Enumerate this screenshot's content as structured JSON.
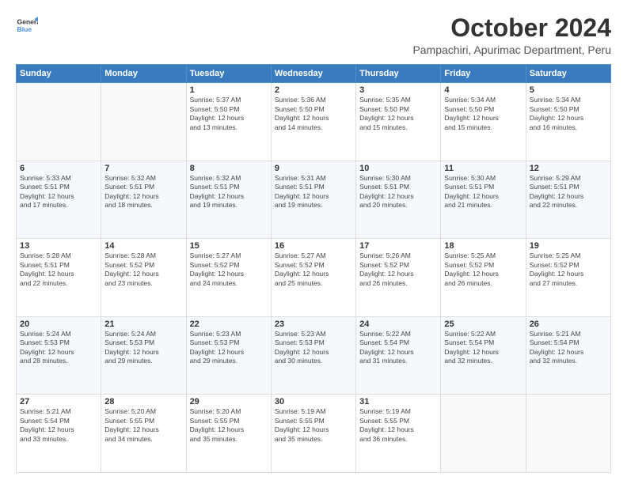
{
  "header": {
    "logo_line1": "General",
    "logo_line2": "Blue",
    "title": "October 2024",
    "subtitle": "Pampachiri, Apurimac Department, Peru"
  },
  "days_of_week": [
    "Sunday",
    "Monday",
    "Tuesday",
    "Wednesday",
    "Thursday",
    "Friday",
    "Saturday"
  ],
  "weeks": [
    [
      {
        "day": "",
        "empty": true
      },
      {
        "day": "",
        "empty": true
      },
      {
        "day": "1",
        "sunrise": "5:37 AM",
        "sunset": "5:50 PM",
        "daylight": "12 hours and 13 minutes."
      },
      {
        "day": "2",
        "sunrise": "5:36 AM",
        "sunset": "5:50 PM",
        "daylight": "12 hours and 14 minutes."
      },
      {
        "day": "3",
        "sunrise": "5:35 AM",
        "sunset": "5:50 PM",
        "daylight": "12 hours and 15 minutes."
      },
      {
        "day": "4",
        "sunrise": "5:34 AM",
        "sunset": "5:50 PM",
        "daylight": "12 hours and 15 minutes."
      },
      {
        "day": "5",
        "sunrise": "5:34 AM",
        "sunset": "5:50 PM",
        "daylight": "12 hours and 16 minutes."
      }
    ],
    [
      {
        "day": "6",
        "sunrise": "5:33 AM",
        "sunset": "5:51 PM",
        "daylight": "12 hours and 17 minutes."
      },
      {
        "day": "7",
        "sunrise": "5:32 AM",
        "sunset": "5:51 PM",
        "daylight": "12 hours and 18 minutes."
      },
      {
        "day": "8",
        "sunrise": "5:32 AM",
        "sunset": "5:51 PM",
        "daylight": "12 hours and 19 minutes."
      },
      {
        "day": "9",
        "sunrise": "5:31 AM",
        "sunset": "5:51 PM",
        "daylight": "12 hours and 19 minutes."
      },
      {
        "day": "10",
        "sunrise": "5:30 AM",
        "sunset": "5:51 PM",
        "daylight": "12 hours and 20 minutes."
      },
      {
        "day": "11",
        "sunrise": "5:30 AM",
        "sunset": "5:51 PM",
        "daylight": "12 hours and 21 minutes."
      },
      {
        "day": "12",
        "sunrise": "5:29 AM",
        "sunset": "5:51 PM",
        "daylight": "12 hours and 22 minutes."
      }
    ],
    [
      {
        "day": "13",
        "sunrise": "5:28 AM",
        "sunset": "5:51 PM",
        "daylight": "12 hours and 22 minutes."
      },
      {
        "day": "14",
        "sunrise": "5:28 AM",
        "sunset": "5:52 PM",
        "daylight": "12 hours and 23 minutes."
      },
      {
        "day": "15",
        "sunrise": "5:27 AM",
        "sunset": "5:52 PM",
        "daylight": "12 hours and 24 minutes."
      },
      {
        "day": "16",
        "sunrise": "5:27 AM",
        "sunset": "5:52 PM",
        "daylight": "12 hours and 25 minutes."
      },
      {
        "day": "17",
        "sunrise": "5:26 AM",
        "sunset": "5:52 PM",
        "daylight": "12 hours and 26 minutes."
      },
      {
        "day": "18",
        "sunrise": "5:25 AM",
        "sunset": "5:52 PM",
        "daylight": "12 hours and 26 minutes."
      },
      {
        "day": "19",
        "sunrise": "5:25 AM",
        "sunset": "5:52 PM",
        "daylight": "12 hours and 27 minutes."
      }
    ],
    [
      {
        "day": "20",
        "sunrise": "5:24 AM",
        "sunset": "5:53 PM",
        "daylight": "12 hours and 28 minutes."
      },
      {
        "day": "21",
        "sunrise": "5:24 AM",
        "sunset": "5:53 PM",
        "daylight": "12 hours and 29 minutes."
      },
      {
        "day": "22",
        "sunrise": "5:23 AM",
        "sunset": "5:53 PM",
        "daylight": "12 hours and 29 minutes."
      },
      {
        "day": "23",
        "sunrise": "5:23 AM",
        "sunset": "5:53 PM",
        "daylight": "12 hours and 30 minutes."
      },
      {
        "day": "24",
        "sunrise": "5:22 AM",
        "sunset": "5:54 PM",
        "daylight": "12 hours and 31 minutes."
      },
      {
        "day": "25",
        "sunrise": "5:22 AM",
        "sunset": "5:54 PM",
        "daylight": "12 hours and 32 minutes."
      },
      {
        "day": "26",
        "sunrise": "5:21 AM",
        "sunset": "5:54 PM",
        "daylight": "12 hours and 32 minutes."
      }
    ],
    [
      {
        "day": "27",
        "sunrise": "5:21 AM",
        "sunset": "5:54 PM",
        "daylight": "12 hours and 33 minutes."
      },
      {
        "day": "28",
        "sunrise": "5:20 AM",
        "sunset": "5:55 PM",
        "daylight": "12 hours and 34 minutes."
      },
      {
        "day": "29",
        "sunrise": "5:20 AM",
        "sunset": "5:55 PM",
        "daylight": "12 hours and 35 minutes."
      },
      {
        "day": "30",
        "sunrise": "5:19 AM",
        "sunset": "5:55 PM",
        "daylight": "12 hours and 35 minutes."
      },
      {
        "day": "31",
        "sunrise": "5:19 AM",
        "sunset": "5:55 PM",
        "daylight": "12 hours and 36 minutes."
      },
      {
        "day": "",
        "empty": true
      },
      {
        "day": "",
        "empty": true
      }
    ]
  ],
  "labels": {
    "sunrise": "Sunrise:",
    "sunset": "Sunset:",
    "daylight": "Daylight:"
  }
}
